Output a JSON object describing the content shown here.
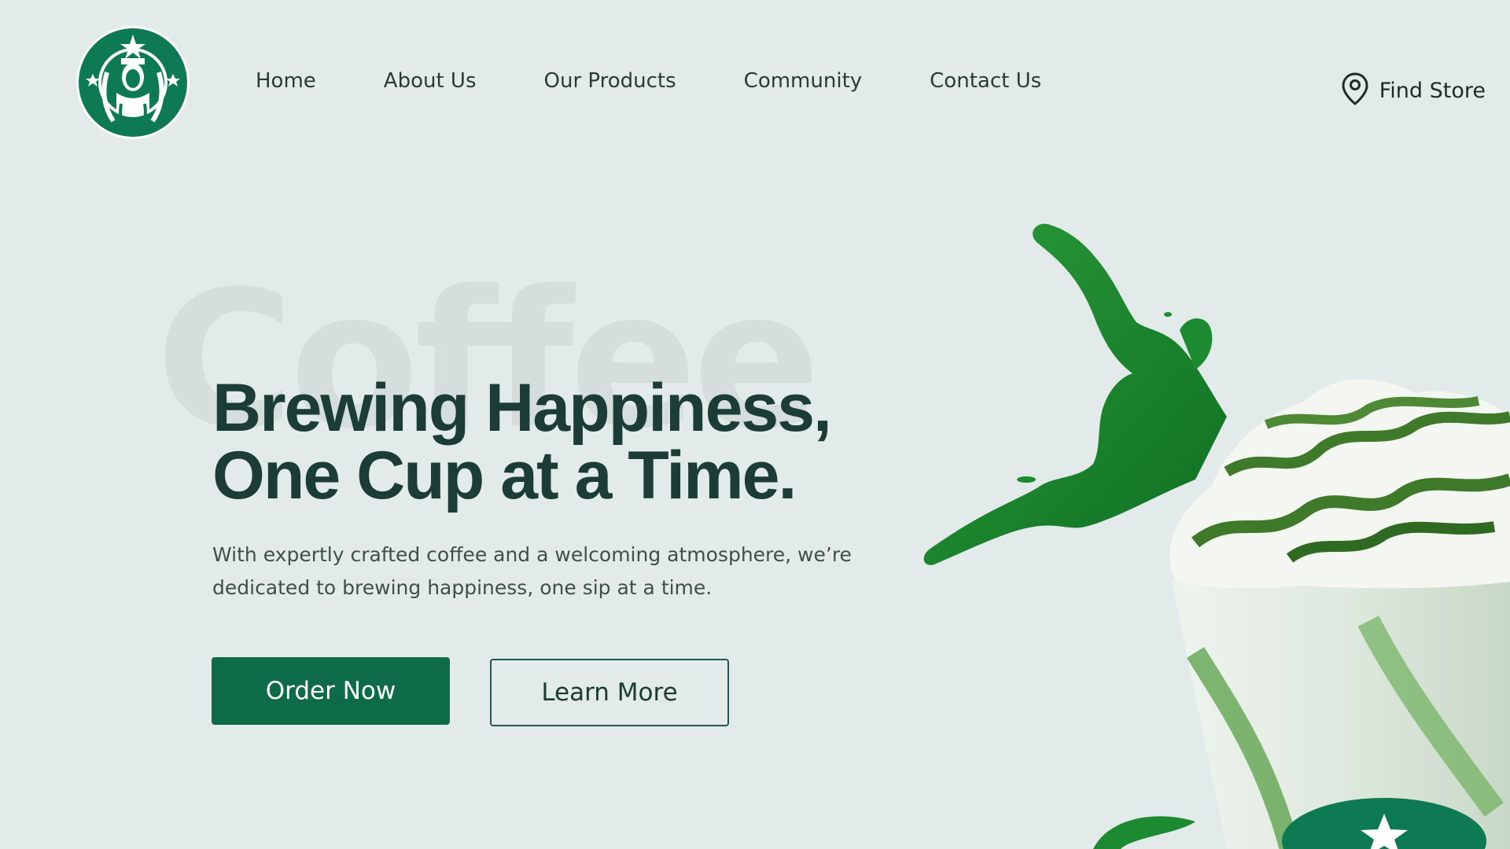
{
  "brand": {
    "logo": "siren-logo-icon",
    "colors": {
      "primary": "#0e6b48",
      "heading": "#1b3d36",
      "background": "#e3ebea",
      "logo_green": "#0d7a54"
    }
  },
  "nav": {
    "items": [
      {
        "label": "Home"
      },
      {
        "label": "About Us"
      },
      {
        "label": "Our Products"
      },
      {
        "label": "Community"
      },
      {
        "label": "Contact Us"
      }
    ],
    "find_store": {
      "label": "Find Store",
      "icon": "map-pin-icon"
    }
  },
  "hero": {
    "watermark": "Coffee",
    "headline_line1": "Brewing Happiness,",
    "headline_line2": "One Cup at a Time.",
    "description_line1": "With expertly crafted coffee and a welcoming atmosphere, we’re",
    "description_line2": "dedicated to brewing happiness, one sip at a time.",
    "primary_button": "Order Now",
    "secondary_button": "Learn More",
    "image": "matcha-frappuccino-splash-image"
  }
}
